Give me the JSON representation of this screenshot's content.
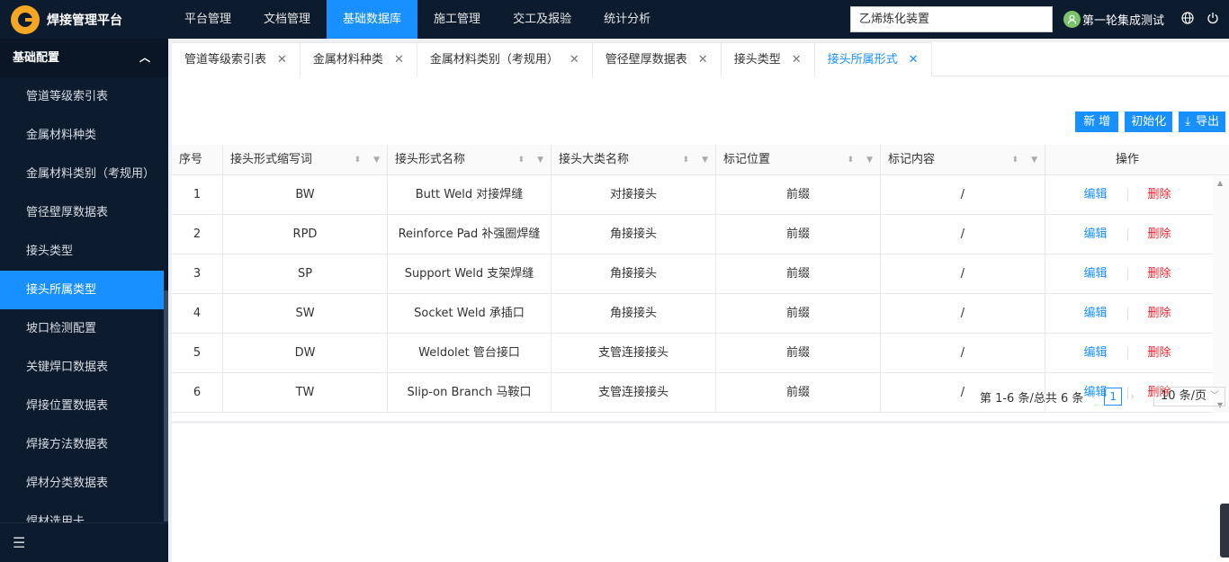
{
  "app": {
    "title": "焊接管理平台"
  },
  "nav": [
    "平台管理",
    "文档管理",
    "基础数据库",
    "施工管理",
    "交工及报验",
    "统计分析"
  ],
  "nav_active": 2,
  "project_select": "乙烯炼化装置",
  "user": {
    "name": "第一轮集成测试"
  },
  "icons": {
    "globe": "globe-icon",
    "logout": "power-icon",
    "collapse": "menu-fold-icon"
  },
  "sidebar": {
    "group": "基础配置",
    "items": [
      "管道等级索引表",
      "金属材料种类",
      "金属材料类别（考规用）",
      "管径壁厚数据表",
      "接头类型",
      "接头所属类型",
      "坡口检测配置",
      "关键焊口数据表",
      "焊接位置数据表",
      "焊接方法数据表",
      "焊材分类数据表",
      "焊材选用卡"
    ],
    "active": 5
  },
  "tabs": [
    "管道等级索引表",
    "金属材料种类",
    "金属材料类别（考规用）",
    "管径壁厚数据表",
    "接头类型",
    "接头所属形式"
  ],
  "tab_active": 5,
  "toolbar": {
    "new": "新增",
    "init": "初始化",
    "export": "导出"
  },
  "table": {
    "headers": [
      "序号",
      "接头形式缩写词",
      "接头形式名称",
      "接头大类名称",
      "标记位置",
      "标记内容",
      "操作"
    ],
    "rows": [
      [
        "1",
        "BW",
        "Butt Weld 对接焊缝",
        "对接接头",
        "前缀",
        "/"
      ],
      [
        "2",
        "RPD",
        "Reinforce Pad 补强圈焊缝",
        "角接接头",
        "前缀",
        "/"
      ],
      [
        "3",
        "SP",
        "Support Weld 支架焊缝",
        "角接接头",
        "前缀",
        "/"
      ],
      [
        "4",
        "SW",
        "Socket Weld 承插口",
        "角接接头",
        "前缀",
        "/"
      ],
      [
        "5",
        "DW",
        "Weldolet 管台接口",
        "支管连接接头",
        "前缀",
        "/"
      ],
      [
        "6",
        "TW",
        "Slip-on Branch 马鞍口",
        "支管连接接头",
        "前缀",
        "/"
      ]
    ],
    "op_edit": "编辑",
    "op_delete": "删除"
  },
  "pager": {
    "summary": "第 1-6 条/总共 6 条",
    "current": "1",
    "page_size": "10 条/页"
  },
  "colors": {
    "accent": "#1890ff",
    "nav_bg": "#0d1b2e",
    "danger": "#f5222d"
  }
}
